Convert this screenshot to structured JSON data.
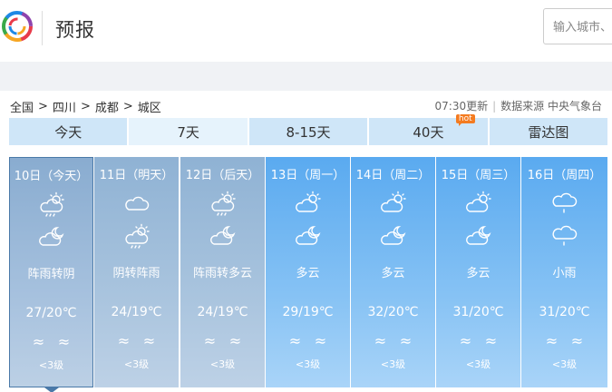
{
  "header": {
    "title": "预报",
    "search_placeholder": "输入城市、"
  },
  "breadcrumb": [
    "全国",
    "四川",
    "成都",
    "城区"
  ],
  "meta": {
    "updated": "07:30更新",
    "source": "数据来源 中央气象台"
  },
  "tabs": [
    {
      "label": "今天",
      "active": false
    },
    {
      "label": "7天",
      "active": true
    },
    {
      "label": "8-15天",
      "active": false
    },
    {
      "label": "40天",
      "active": false,
      "badge": "hot"
    },
    {
      "label": "雷达图",
      "active": false
    }
  ],
  "days": [
    {
      "date": "10日（今天）",
      "day_icon": "thunder-shower-icon",
      "night_icon": "partly-cloudy-night-icon",
      "condition": "阵雨转阴",
      "temp": "27/20℃",
      "wind": "<3级"
    },
    {
      "date": "11日（明天）",
      "day_icon": "cloudy-icon",
      "night_icon": "thunder-shower-icon",
      "condition": "阴转阵雨",
      "temp": "24/19℃",
      "wind": "<3级"
    },
    {
      "date": "12日（后天）",
      "day_icon": "thunder-shower-icon",
      "night_icon": "partly-cloudy-night-icon",
      "condition": "阵雨转多云",
      "temp": "24/19℃",
      "wind": "<3级"
    },
    {
      "date": "13日（周一）",
      "day_icon": "partly-cloudy-day-icon",
      "night_icon": "partly-cloudy-night-icon",
      "condition": "多云",
      "temp": "29/19℃",
      "wind": "<3级"
    },
    {
      "date": "14日（周二）",
      "day_icon": "partly-cloudy-day-icon",
      "night_icon": "partly-cloudy-night-icon",
      "condition": "多云",
      "temp": "32/20℃",
      "wind": "<3级"
    },
    {
      "date": "15日（周三）",
      "day_icon": "partly-cloudy-day-icon",
      "night_icon": "partly-cloudy-night-icon",
      "condition": "多云",
      "temp": "31/20℃",
      "wind": "<3级"
    },
    {
      "date": "16日（周四）",
      "day_icon": "light-rain-icon",
      "night_icon": "light-rain-icon",
      "condition": "小雨",
      "temp": "31/20℃",
      "wind": "<3级"
    }
  ],
  "wind_glyph": "≈",
  "colors": {
    "past_card": "#8fb2d4",
    "future_card": "#5aaaf0",
    "tab_bg": "#cfe6f8",
    "hot_badge": "#f47b20"
  }
}
